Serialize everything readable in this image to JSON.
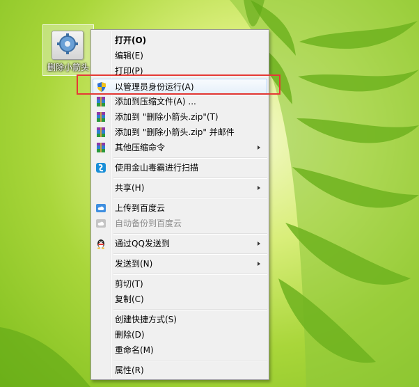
{
  "desktop_icon": {
    "label": "删除小箭头"
  },
  "menu": {
    "items": [
      {
        "label": "打开(O)",
        "bold": true
      },
      {
        "label": "编辑(E)"
      },
      {
        "label": "打印(P)"
      },
      {
        "label": "以管理员身份运行(A)",
        "icon": "uac-shield-icon",
        "highlighted": true
      },
      {
        "label": "添加到压缩文件(A) ...",
        "icon": "winrar-icon"
      },
      {
        "label": "添加到 \"删除小箭头.zip\"(T)",
        "icon": "winrar-icon"
      },
      {
        "label": "添加到 \"删除小箭头.zip\" 并邮件",
        "icon": "winrar-icon"
      },
      {
        "label": "其他压缩命令",
        "icon": "winrar-icon",
        "submenu": true
      },
      {
        "label": "使用金山毒霸进行扫描",
        "icon": "kingsoft-antivirus-icon"
      },
      {
        "label": "共享(H)",
        "submenu": true
      },
      {
        "label": "上传到百度云",
        "icon": "baidu-cloud-icon"
      },
      {
        "label": "自动备份到百度云",
        "icon": "baidu-cloud-icon",
        "disabled": true
      },
      {
        "label": "通过QQ发送到",
        "icon": "qq-penguin-icon",
        "submenu": true
      },
      {
        "label": "发送到(N)",
        "submenu": true
      },
      {
        "label": "剪切(T)"
      },
      {
        "label": "复制(C)"
      },
      {
        "label": "创建快捷方式(S)"
      },
      {
        "label": "删除(D)"
      },
      {
        "label": "重命名(M)"
      },
      {
        "label": "属性(R)"
      }
    ]
  },
  "colors": {
    "annotation_box": "#e53935",
    "menu_bg": "#f0f0f0"
  }
}
